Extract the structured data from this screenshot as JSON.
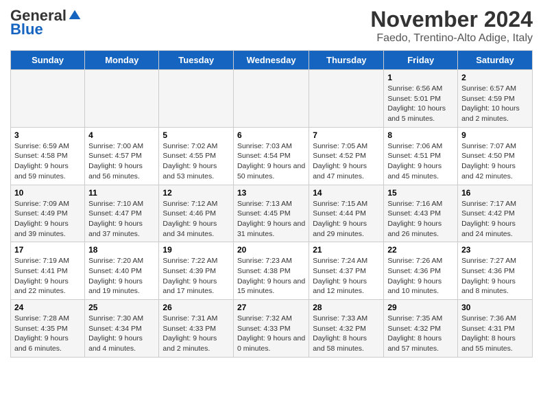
{
  "logo": {
    "general": "General",
    "blue": "Blue"
  },
  "title": {
    "month": "November 2024",
    "location": "Faedo, Trentino-Alto Adige, Italy"
  },
  "headers": [
    "Sunday",
    "Monday",
    "Tuesday",
    "Wednesday",
    "Thursday",
    "Friday",
    "Saturday"
  ],
  "weeks": [
    [
      {
        "day": "",
        "info": ""
      },
      {
        "day": "",
        "info": ""
      },
      {
        "day": "",
        "info": ""
      },
      {
        "day": "",
        "info": ""
      },
      {
        "day": "",
        "info": ""
      },
      {
        "day": "1",
        "info": "Sunrise: 6:56 AM\nSunset: 5:01 PM\nDaylight: 10 hours and 5 minutes."
      },
      {
        "day": "2",
        "info": "Sunrise: 6:57 AM\nSunset: 4:59 PM\nDaylight: 10 hours and 2 minutes."
      }
    ],
    [
      {
        "day": "3",
        "info": "Sunrise: 6:59 AM\nSunset: 4:58 PM\nDaylight: 9 hours and 59 minutes."
      },
      {
        "day": "4",
        "info": "Sunrise: 7:00 AM\nSunset: 4:57 PM\nDaylight: 9 hours and 56 minutes."
      },
      {
        "day": "5",
        "info": "Sunrise: 7:02 AM\nSunset: 4:55 PM\nDaylight: 9 hours and 53 minutes."
      },
      {
        "day": "6",
        "info": "Sunrise: 7:03 AM\nSunset: 4:54 PM\nDaylight: 9 hours and 50 minutes."
      },
      {
        "day": "7",
        "info": "Sunrise: 7:05 AM\nSunset: 4:52 PM\nDaylight: 9 hours and 47 minutes."
      },
      {
        "day": "8",
        "info": "Sunrise: 7:06 AM\nSunset: 4:51 PM\nDaylight: 9 hours and 45 minutes."
      },
      {
        "day": "9",
        "info": "Sunrise: 7:07 AM\nSunset: 4:50 PM\nDaylight: 9 hours and 42 minutes."
      }
    ],
    [
      {
        "day": "10",
        "info": "Sunrise: 7:09 AM\nSunset: 4:49 PM\nDaylight: 9 hours and 39 minutes."
      },
      {
        "day": "11",
        "info": "Sunrise: 7:10 AM\nSunset: 4:47 PM\nDaylight: 9 hours and 37 minutes."
      },
      {
        "day": "12",
        "info": "Sunrise: 7:12 AM\nSunset: 4:46 PM\nDaylight: 9 hours and 34 minutes."
      },
      {
        "day": "13",
        "info": "Sunrise: 7:13 AM\nSunset: 4:45 PM\nDaylight: 9 hours and 31 minutes."
      },
      {
        "day": "14",
        "info": "Sunrise: 7:15 AM\nSunset: 4:44 PM\nDaylight: 9 hours and 29 minutes."
      },
      {
        "day": "15",
        "info": "Sunrise: 7:16 AM\nSunset: 4:43 PM\nDaylight: 9 hours and 26 minutes."
      },
      {
        "day": "16",
        "info": "Sunrise: 7:17 AM\nSunset: 4:42 PM\nDaylight: 9 hours and 24 minutes."
      }
    ],
    [
      {
        "day": "17",
        "info": "Sunrise: 7:19 AM\nSunset: 4:41 PM\nDaylight: 9 hours and 22 minutes."
      },
      {
        "day": "18",
        "info": "Sunrise: 7:20 AM\nSunset: 4:40 PM\nDaylight: 9 hours and 19 minutes."
      },
      {
        "day": "19",
        "info": "Sunrise: 7:22 AM\nSunset: 4:39 PM\nDaylight: 9 hours and 17 minutes."
      },
      {
        "day": "20",
        "info": "Sunrise: 7:23 AM\nSunset: 4:38 PM\nDaylight: 9 hours and 15 minutes."
      },
      {
        "day": "21",
        "info": "Sunrise: 7:24 AM\nSunset: 4:37 PM\nDaylight: 9 hours and 12 minutes."
      },
      {
        "day": "22",
        "info": "Sunrise: 7:26 AM\nSunset: 4:36 PM\nDaylight: 9 hours and 10 minutes."
      },
      {
        "day": "23",
        "info": "Sunrise: 7:27 AM\nSunset: 4:36 PM\nDaylight: 9 hours and 8 minutes."
      }
    ],
    [
      {
        "day": "24",
        "info": "Sunrise: 7:28 AM\nSunset: 4:35 PM\nDaylight: 9 hours and 6 minutes."
      },
      {
        "day": "25",
        "info": "Sunrise: 7:30 AM\nSunset: 4:34 PM\nDaylight: 9 hours and 4 minutes."
      },
      {
        "day": "26",
        "info": "Sunrise: 7:31 AM\nSunset: 4:33 PM\nDaylight: 9 hours and 2 minutes."
      },
      {
        "day": "27",
        "info": "Sunrise: 7:32 AM\nSunset: 4:33 PM\nDaylight: 9 hours and 0 minutes."
      },
      {
        "day": "28",
        "info": "Sunrise: 7:33 AM\nSunset: 4:32 PM\nDaylight: 8 hours and 58 minutes."
      },
      {
        "day": "29",
        "info": "Sunrise: 7:35 AM\nSunset: 4:32 PM\nDaylight: 8 hours and 57 minutes."
      },
      {
        "day": "30",
        "info": "Sunrise: 7:36 AM\nSunset: 4:31 PM\nDaylight: 8 hours and 55 minutes."
      }
    ]
  ]
}
